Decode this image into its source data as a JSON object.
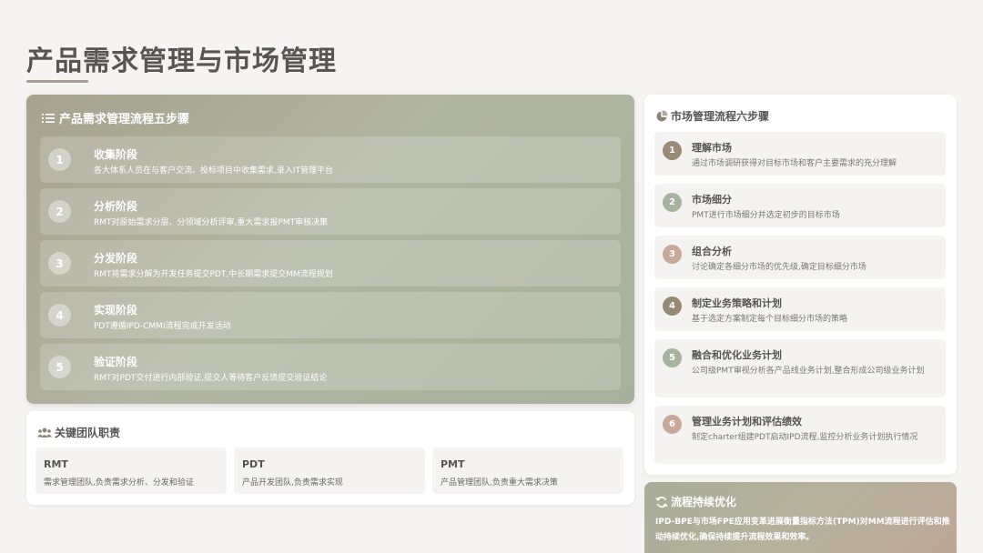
{
  "page": {
    "title": "产品需求管理与市场管理"
  },
  "requirement_flow": {
    "heading": "产品需求管理流程五步骤",
    "steps": [
      {
        "num": "1",
        "title": "收集阶段",
        "desc": "各大体系人员在与客户交流、投标项目中收集需求,录入IT管理平台"
      },
      {
        "num": "2",
        "title": "分析阶段",
        "desc": "RMT对原始需求分层、分领域分析评审,重大需求报PMT审核决策"
      },
      {
        "num": "3",
        "title": "分发阶段",
        "desc": "RMT将需求分解为开发任务提交PDT,中长期需求提交MM流程规划"
      },
      {
        "num": "4",
        "title": "实现阶段",
        "desc": "PDT遵循IPD-CMMI流程完成开发活动"
      },
      {
        "num": "5",
        "title": "验证阶段",
        "desc": "RMT对PDT交付进行内部验证,提交人等待客户反馈提交验证结论"
      }
    ]
  },
  "teams": {
    "heading": "关键团队职责",
    "items": [
      {
        "name": "RMT",
        "desc": "需求管理团队,负责需求分析、分发和验证"
      },
      {
        "name": "PDT",
        "desc": "产品开发团队,负责需求实现"
      },
      {
        "name": "PMT",
        "desc": "产品管理团队,负责重大需求决策"
      }
    ]
  },
  "market_flow": {
    "heading": "市场管理流程六步骤",
    "steps": [
      {
        "num": "1",
        "title": "理解市场",
        "desc": "通过市场调研获得对目标市场和客户主要需求的充分理解",
        "color": "#9a8a78"
      },
      {
        "num": "2",
        "title": "市场细分",
        "desc": "PMT进行市场细分并选定初步的目标市场",
        "color": "#a6b39e"
      },
      {
        "num": "3",
        "title": "组合分析",
        "desc": "讨论确定各细分市场的优先级,确定目标细分市场",
        "color": "#c8a89a"
      },
      {
        "num": "4",
        "title": "制定业务策略和计划",
        "desc": "基于选定方案制定每个目标细分市场的策略",
        "color": "#958a74"
      },
      {
        "num": "5",
        "title": "融合和优化业务计划",
        "desc": "公司级PMT审视分析各产品线业务计划,整合形成公司级业务计划",
        "color": "#a6b39e"
      },
      {
        "num": "6",
        "title": "管理业务计划和评估绩效",
        "desc": "制定charter组建PDT启动IPD流程,监控分析业务计划执行情况",
        "color": "#c8a89a"
      }
    ]
  },
  "optimization": {
    "heading": "流程持续优化",
    "desc": "IPD-BPE与市场FPE应用变革进展衡量指标方法(TPM)对MM流程进行评估和推动持续优化,确保持续提升流程效果和效率。"
  }
}
